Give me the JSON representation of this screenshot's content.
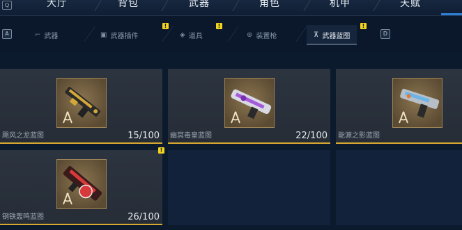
{
  "keys": {
    "top_left": "Q",
    "sub_left": "A",
    "sub_right": "D"
  },
  "top_tabs": [
    {
      "label": "大厅"
    },
    {
      "label": "背包"
    },
    {
      "label": "武器"
    },
    {
      "label": "角色"
    },
    {
      "label": "机甲"
    },
    {
      "label": "天赋"
    }
  ],
  "sub_tabs": [
    {
      "label": "武器",
      "icon": "gun-icon"
    },
    {
      "label": "武器插件",
      "icon": "plugin-icon"
    },
    {
      "label": "道具",
      "icon": "item-icon"
    },
    {
      "label": "装置枪",
      "icon": "device-gun-icon"
    },
    {
      "label": "武器蓝图",
      "icon": "blueprint-icon",
      "active": true
    }
  ],
  "badge_mark": "!",
  "blueprints": [
    {
      "name": "飓风之龙蓝图",
      "count": "15/100",
      "weapon_color": "#d4a838"
    },
    {
      "name": "幽冥毒皇蓝图",
      "count": "22/100",
      "weapon_color": "#a45bd9"
    },
    {
      "name": "能源之影蓝图",
      "count": "",
      "weapon_color": "#6ab4e8"
    },
    {
      "name": "钢铁轰鸣蓝图",
      "count": "26/100",
      "weapon_color": "#d63a3a"
    }
  ],
  "colors": {
    "accent_blue": "#2f7fd6",
    "card_border": "#d8a92e",
    "badge": "#f2d51e"
  }
}
